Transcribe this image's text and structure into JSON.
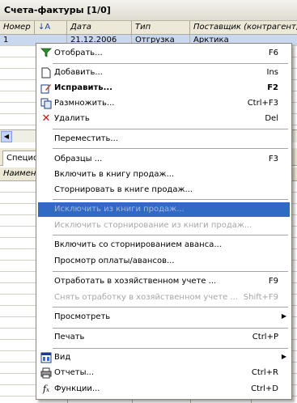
{
  "window": {
    "title": "Счета-фактуры [1/0]"
  },
  "grid": {
    "columns": [
      "Номер",
      "Дата",
      "Тип",
      "Поставщик (контрагент, ..."
    ],
    "rows": [
      [
        "1",
        "21.12.2006",
        "Отгрузка",
        "Арктика"
      ]
    ]
  },
  "tabs": {
    "active": "Специф"
  },
  "subgrid": {
    "column": "Наимен"
  },
  "context_menu": {
    "items": [
      {
        "label": "Отобрать...",
        "shortcut": "F6",
        "icon": "filter-icon"
      },
      {
        "label": "Добавить...",
        "shortcut": "Ins",
        "icon": "new-document-icon"
      },
      {
        "label": "Исправить...",
        "shortcut": "F2",
        "icon": "edit-icon"
      },
      {
        "label": "Размножить...",
        "shortcut": "Ctrl+F3",
        "icon": "copy-icon"
      },
      {
        "label": "Удалить",
        "shortcut": "Del",
        "icon": "delete-icon"
      },
      {
        "label": "Переместить..."
      },
      {
        "label": "Образцы ...",
        "shortcut": "F3"
      },
      {
        "label": "Включить в книгу продаж..."
      },
      {
        "label": "Сторнировать в книге продаж..."
      },
      {
        "label": "Исключить из книги продаж..."
      },
      {
        "label": "Исключить сторнирование из книги продаж..."
      },
      {
        "label": "Включить со сторнированием аванса..."
      },
      {
        "label": "Просмотр оплаты/авансов..."
      },
      {
        "label": "Отработать в хозяйственном учете ...",
        "shortcut": "F9"
      },
      {
        "label": "Снять отработку в хозяйственном учете ...",
        "shortcut": "Shift+F9"
      },
      {
        "label": "Просмотреть"
      },
      {
        "label": "Печать",
        "shortcut": "Ctrl+P"
      },
      {
        "label": "Вид",
        "icon": "view-icon"
      },
      {
        "label": "Отчеты...",
        "shortcut": "Ctrl+R",
        "icon": "printer-icon"
      },
      {
        "label": "Функции...",
        "shortcut": "Ctrl+D",
        "icon": "function-icon"
      }
    ]
  },
  "colors": {
    "highlight": "#316ac5",
    "disabled_text": "#a6a6a6",
    "selected_row": "#c9d7ef"
  }
}
